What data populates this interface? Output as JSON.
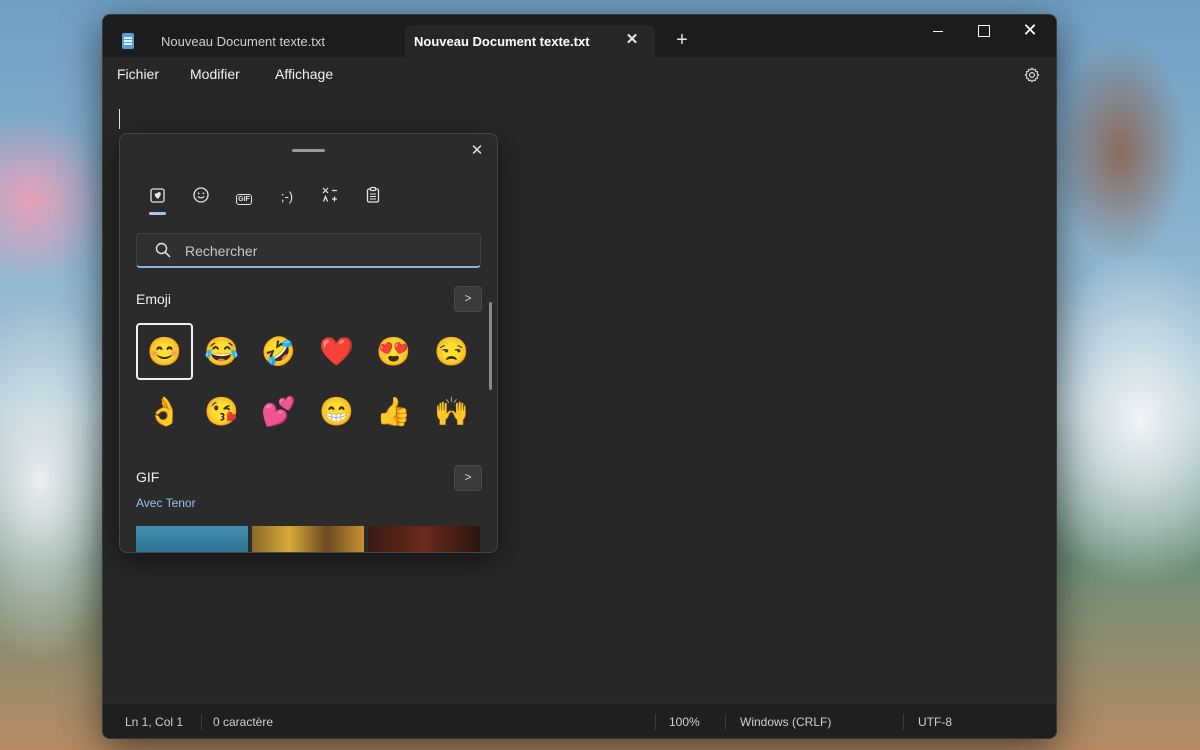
{
  "window": {
    "tabs": [
      {
        "label": "Nouveau Document texte.txt",
        "active": false
      },
      {
        "label": "Nouveau Document texte.txt",
        "active": true
      }
    ],
    "new_tab": "+",
    "close_tab": "✕",
    "close_window": "✕"
  },
  "menu": {
    "file": "Fichier",
    "edit": "Modifier",
    "view": "Affichage"
  },
  "status": {
    "position": "Ln 1, Col 1",
    "chars": "0 caractère",
    "zoom": "100%",
    "line_ending": "Windows (CRLF)",
    "encoding": "UTF-8"
  },
  "picker": {
    "close": "✕",
    "categories": [
      "favorites-icon",
      "smiley-icon",
      "gif-icon",
      "kaomoji-icon",
      "symbols-icon",
      "clipboard-icon"
    ],
    "gif_label": "GIF",
    "kaomoji_label": ";-)",
    "search_placeholder": "Rechercher",
    "emoji_section": {
      "title": "Emoji",
      "more": ">",
      "items": [
        "😊",
        "😂",
        "🤣",
        "❤️",
        "😍",
        "😒",
        "👌",
        "😘",
        "💕",
        "😁",
        "👍",
        "🙌"
      ]
    },
    "gif_section": {
      "title": "GIF",
      "subtitle": "Avec Tenor",
      "more": ">"
    }
  },
  "colors": {
    "accent": "#8db4e0",
    "window_bg": "#272727",
    "titlebar_bg": "#1c1c1c"
  }
}
